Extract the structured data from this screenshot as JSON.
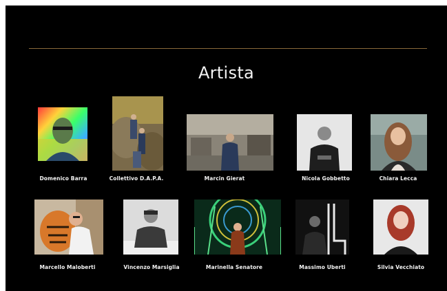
{
  "title": "Artista",
  "artists": [
    {
      "name": "Domenico Barra"
    },
    {
      "name": "Collettivo D.A.P.A."
    },
    {
      "name": "Marcin Gierat"
    },
    {
      "name": "Nicola Gobbetto"
    },
    {
      "name": "Chiara Lecca"
    },
    {
      "name": "Marcello Maloberti"
    },
    {
      "name": "Vincenzo Marsiglia"
    },
    {
      "name": "Marinella Senatore"
    },
    {
      "name": "Massimo Uberti"
    },
    {
      "name": "Silvia Vecchiato"
    }
  ]
}
